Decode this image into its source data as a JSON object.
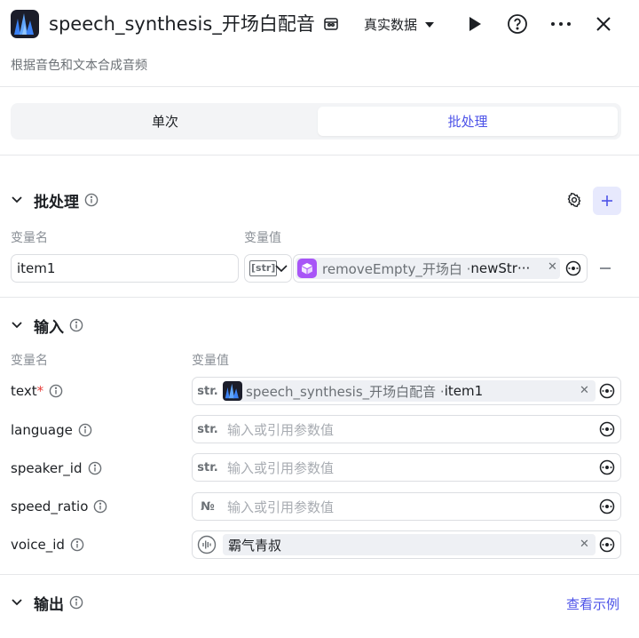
{
  "header": {
    "title": "speech_synthesis_开场白配音",
    "data_source": "真实数据",
    "subtitle": "根据音色和文本合成音频"
  },
  "tabs": [
    {
      "label": "单次"
    },
    {
      "label": "批处理"
    }
  ],
  "batch": {
    "title": "批处理",
    "col_name": "变量名",
    "col_value": "变量值",
    "item_name": "item1",
    "item_type": "[str]",
    "ref_node": "removeEmpty_开场白 · ",
    "ref_var": "newStr···"
  },
  "input": {
    "title": "输入",
    "col_name": "变量名",
    "col_value": "变量值",
    "rows": [
      {
        "name": "text",
        "required": "*",
        "type": "str.",
        "ref_node": "speech_synthesis_开场白配音 · ",
        "ref_var": "item1"
      },
      {
        "name": "language",
        "type": "str.",
        "placeholder": "输入或引用参数值"
      },
      {
        "name": "speaker_id",
        "type": "str.",
        "placeholder": "输入或引用参数值"
      },
      {
        "name": "speed_ratio",
        "type": "№",
        "placeholder": "输入或引用参数值"
      },
      {
        "name": "voice_id",
        "value": "霸气青叔"
      }
    ]
  },
  "output": {
    "title": "输出",
    "link": "查看示例"
  },
  "colors": {
    "accent": "#4d53e8",
    "required": "#e53935",
    "purple_node": "#a855f7"
  }
}
